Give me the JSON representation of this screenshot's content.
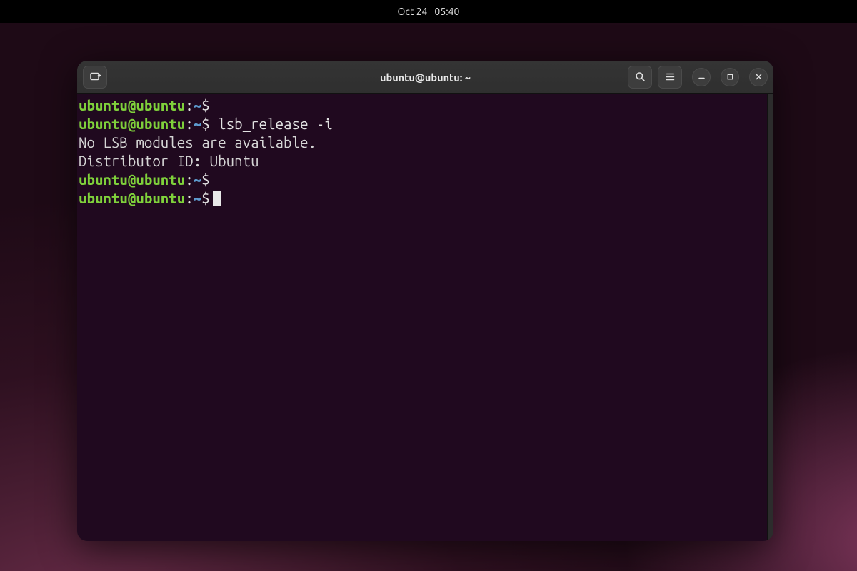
{
  "menubar": {
    "date": "Oct 24",
    "time": "05:40"
  },
  "window": {
    "title": "ubuntu@ubuntu: ~"
  },
  "prompt": {
    "userhost": "ubuntu@ubuntu",
    "colon": ":",
    "path": "~",
    "dollar": "$"
  },
  "terminal": {
    "lines": [
      {
        "type": "prompt",
        "cmd": ""
      },
      {
        "type": "prompt",
        "cmd": " lsb_release -i"
      },
      {
        "type": "output",
        "text": "No LSB modules are available."
      },
      {
        "type": "output",
        "text": "Distributor ID: Ubuntu"
      },
      {
        "type": "prompt",
        "cmd": ""
      },
      {
        "type": "prompt",
        "cmd": "",
        "cursor": true
      }
    ]
  }
}
